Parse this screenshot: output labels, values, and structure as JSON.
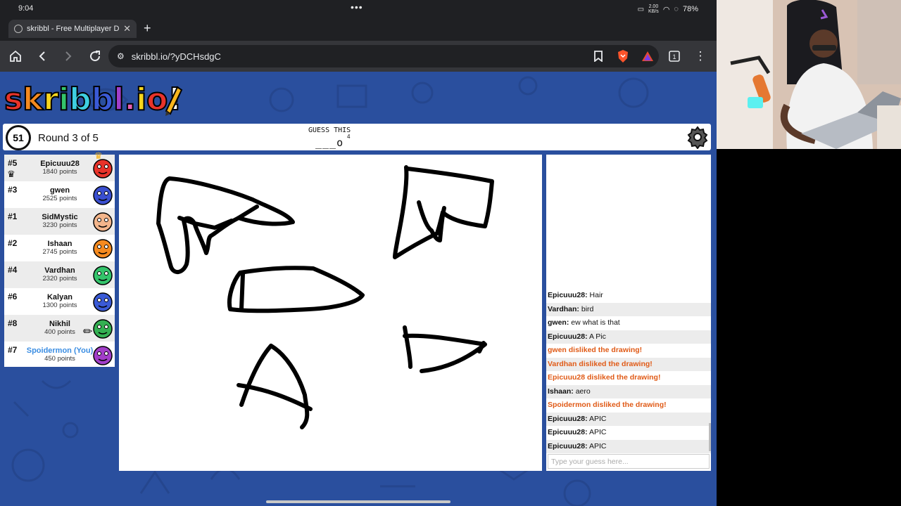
{
  "status_bar": {
    "time": "9:04",
    "battery": "78%",
    "speed_top": "2.00",
    "speed_bottom": "KB/s"
  },
  "tab": {
    "title": "skribbl - Free Multiplayer Dra"
  },
  "address_bar": {
    "url": "skribbl.io/?yDCHsdgC"
  },
  "game": {
    "logo": "skribbl.io",
    "timer": "51",
    "round": "Round 3 of 5",
    "guess_label": "GUESS THIS",
    "word_hint": "___o",
    "word_length": "4"
  },
  "players": [
    {
      "rank": "#5",
      "name": "Epicuuu28",
      "points": "1840 points",
      "color": "#e8332a",
      "owner": true
    },
    {
      "rank": "#3",
      "name": "gwen",
      "points": "2525 points",
      "color": "#3a4fd0"
    },
    {
      "rank": "#1",
      "name": "SidMystic",
      "points": "3230 points",
      "color": "#f3b58b"
    },
    {
      "rank": "#2",
      "name": "Ishaan",
      "points": "2745 points",
      "color": "#f58a1f"
    },
    {
      "rank": "#4",
      "name": "Vardhan",
      "points": "2320 points",
      "color": "#34c46b"
    },
    {
      "rank": "#6",
      "name": "Kalyan",
      "points": "1300 points",
      "color": "#3a5ad6"
    },
    {
      "rank": "#8",
      "name": "Nikhil",
      "points": "400 points",
      "color": "#34b052",
      "drawing": true
    },
    {
      "rank": "#7",
      "name": "Spoidermon (You)",
      "points": "450 points",
      "color": "#a23ec9",
      "you": true
    }
  ],
  "chat": {
    "messages": [
      {
        "user": "Epicuuu28:",
        "text": "Hair"
      },
      {
        "user": "Vardhan:",
        "text": "bird"
      },
      {
        "user": "gwen:",
        "text": "ew what is that"
      },
      {
        "user": "Epicuuu28:",
        "text": "A Pic"
      },
      {
        "system": "gwen disliked the drawing!"
      },
      {
        "system": "Vardhan disliked the drawing!"
      },
      {
        "system": "Epicuuu28 disliked the drawing!"
      },
      {
        "user": "Ishaan:",
        "text": "aero"
      },
      {
        "system": "Spoidermon disliked the drawing!"
      },
      {
        "user": "Epicuuu28:",
        "text": "APIC"
      },
      {
        "user": "Epicuuu28:",
        "text": "APIC"
      },
      {
        "user": "Epicuuu28:",
        "text": "APIC"
      }
    ],
    "input_placeholder": "Type your guess here..."
  },
  "colors": {
    "page_bg": "#2a4f9e",
    "system_msg": "#e05a16",
    "you_name": "#3a8de2"
  }
}
